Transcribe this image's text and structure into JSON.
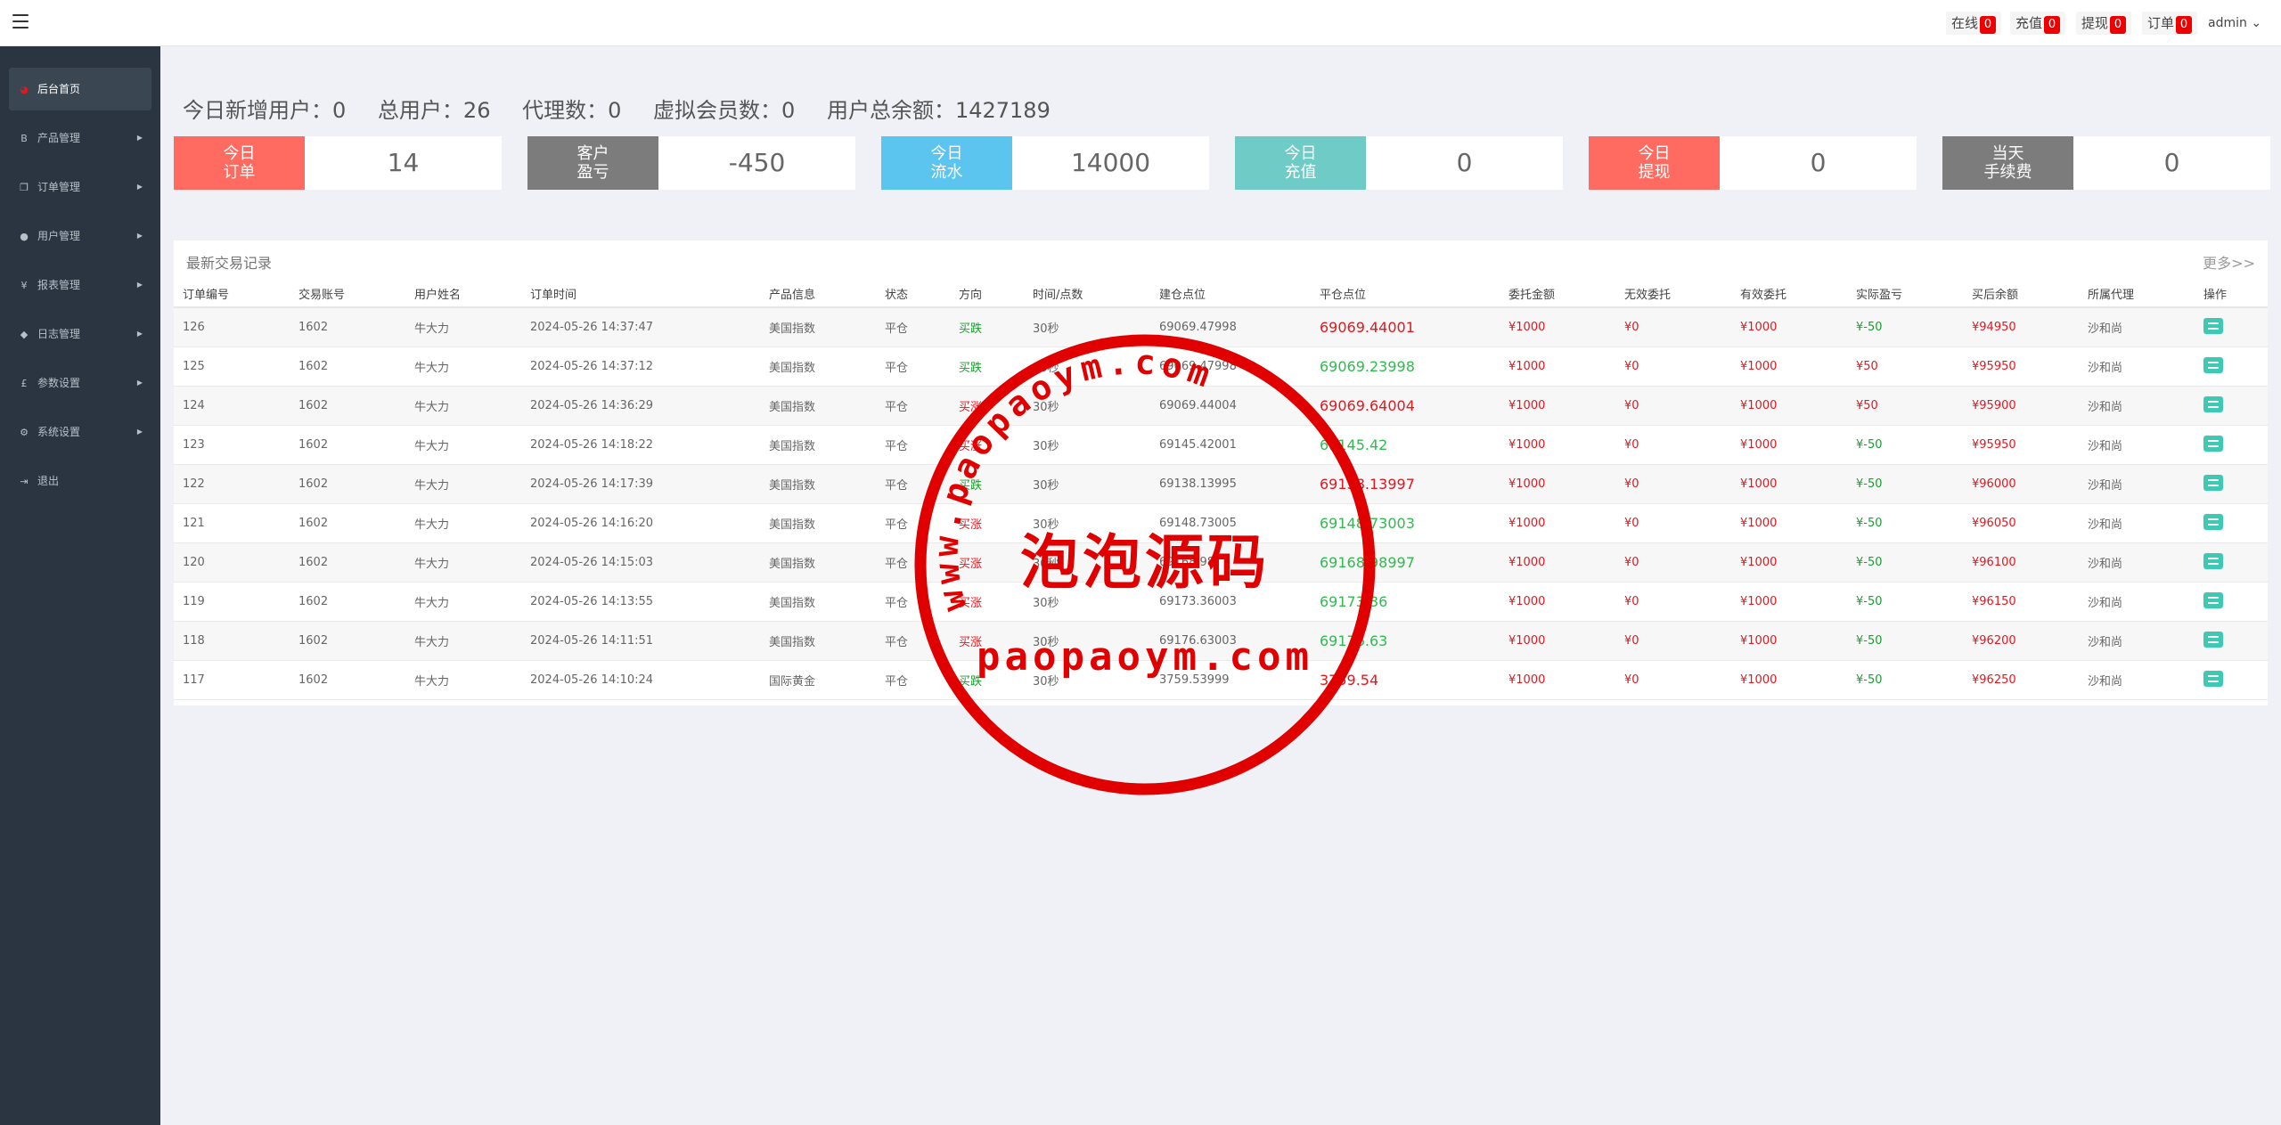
{
  "topbar": {
    "stats": [
      {
        "label": "在线",
        "count": "0"
      },
      {
        "label": "充值",
        "count": "0"
      },
      {
        "label": "提现",
        "count": "0"
      },
      {
        "label": "订单",
        "count": "0"
      }
    ],
    "admin_label": "admin ⌄"
  },
  "sidebar": {
    "items": [
      {
        "label": "后台首页",
        "icon": "dashboard-icon"
      },
      {
        "label": "产品管理",
        "icon": "bitcoin-icon"
      },
      {
        "label": "订单管理",
        "icon": "copy-icon"
      },
      {
        "label": "用户管理",
        "icon": "user-icon"
      },
      {
        "label": "报表管理",
        "icon": "yen-icon"
      },
      {
        "label": "日志管理",
        "icon": "tags-icon"
      },
      {
        "label": "参数设置",
        "icon": "pound-icon"
      },
      {
        "label": "系统设置",
        "icon": "gears-icon"
      },
      {
        "label": "退出",
        "icon": "sign-out-icon"
      }
    ]
  },
  "summary": {
    "new_users": "今日新增用户：0",
    "total_users": "总用户：26",
    "agents": "代理数：0",
    "virtual_members": "虚拟会员数：0",
    "total_balance": "用户总余额：1427189"
  },
  "stat_cards": [
    {
      "label": "今日\n订单",
      "value": "14",
      "color": "#ff6b60"
    },
    {
      "label": "客户\n盈亏",
      "value": "-450",
      "color": "#7c7c7c"
    },
    {
      "label": "今日\n流水",
      "value": "14000",
      "color": "#5bc5f0"
    },
    {
      "label": "今日\n充值",
      "value": "0",
      "color": "#6fcbc6"
    },
    {
      "label": "今日\n提现",
      "value": "0",
      "color": "#ff6b60"
    },
    {
      "label": "当天\n手续费",
      "value": "0",
      "color": "#7c7c7c"
    }
  ],
  "records": {
    "title": "最新交易记录",
    "more": "更多>>",
    "headers": [
      "订单编号",
      "交易账号",
      "用户姓名",
      "订单时间",
      "产品信息",
      "状态",
      "方向",
      "时间/点数",
      "建仓点位",
      "平仓点位",
      "委托金额",
      "无效委托",
      "有效委托",
      "实际盈亏",
      "买后余额",
      "所属代理",
      "操作"
    ],
    "rows": [
      {
        "id": "126",
        "account": "1602",
        "name": "牛大力",
        "time": "2024-05-26 14:37:47",
        "product": "美国指数",
        "status": "平仓",
        "direction": "买跌",
        "dir": "down",
        "period": "30秒",
        "open": "69069.47998",
        "close": "69069.44001",
        "close_up": false,
        "amount": "¥1000",
        "invalid": "¥0",
        "valid": "¥1000",
        "pnl": "¥-50",
        "pnl_pos": false,
        "balance": "¥94950",
        "agent": "沙和尚"
      },
      {
        "id": "125",
        "account": "1602",
        "name": "牛大力",
        "time": "2024-05-26 14:37:12",
        "product": "美国指数",
        "status": "平仓",
        "direction": "买跌",
        "dir": "down",
        "period": "30秒",
        "open": "69069.47998",
        "close": "69069.23998",
        "close_up": true,
        "amount": "¥1000",
        "invalid": "¥0",
        "valid": "¥1000",
        "pnl": "¥50",
        "pnl_pos": true,
        "balance": "¥95950",
        "agent": "沙和尚"
      },
      {
        "id": "124",
        "account": "1602",
        "name": "牛大力",
        "time": "2024-05-26 14:36:29",
        "product": "美国指数",
        "status": "平仓",
        "direction": "买涨",
        "dir": "up",
        "period": "30秒",
        "open": "69069.44004",
        "close": "69069.64004",
        "close_up": false,
        "amount": "¥1000",
        "invalid": "¥0",
        "valid": "¥1000",
        "pnl": "¥50",
        "pnl_pos": true,
        "balance": "¥95900",
        "agent": "沙和尚"
      },
      {
        "id": "123",
        "account": "1602",
        "name": "牛大力",
        "time": "2024-05-26 14:18:22",
        "product": "美国指数",
        "status": "平仓",
        "direction": "买涨",
        "dir": "up",
        "period": "30秒",
        "open": "69145.42001",
        "close": "69145.42",
        "close_up": true,
        "amount": "¥1000",
        "invalid": "¥0",
        "valid": "¥1000",
        "pnl": "¥-50",
        "pnl_pos": false,
        "balance": "¥95950",
        "agent": "沙和尚"
      },
      {
        "id": "122",
        "account": "1602",
        "name": "牛大力",
        "time": "2024-05-26 14:17:39",
        "product": "美国指数",
        "status": "平仓",
        "direction": "买跌",
        "dir": "down",
        "period": "30秒",
        "open": "69138.13995",
        "close": "69138.13997",
        "close_up": false,
        "amount": "¥1000",
        "invalid": "¥0",
        "valid": "¥1000",
        "pnl": "¥-50",
        "pnl_pos": false,
        "balance": "¥96000",
        "agent": "沙和尚"
      },
      {
        "id": "121",
        "account": "1602",
        "name": "牛大力",
        "time": "2024-05-26 14:16:20",
        "product": "美国指数",
        "status": "平仓",
        "direction": "买涨",
        "dir": "up",
        "period": "30秒",
        "open": "69148.73005",
        "close": "69148.73003",
        "close_up": true,
        "amount": "¥1000",
        "invalid": "¥0",
        "valid": "¥1000",
        "pnl": "¥-50",
        "pnl_pos": false,
        "balance": "¥96050",
        "agent": "沙和尚"
      },
      {
        "id": "120",
        "account": "1602",
        "name": "牛大力",
        "time": "2024-05-26 14:15:03",
        "product": "美国指数",
        "status": "平仓",
        "direction": "买涨",
        "dir": "up",
        "period": "30秒",
        "open": "69168.98",
        "close": "69168.98997",
        "close_up": true,
        "amount": "¥1000",
        "invalid": "¥0",
        "valid": "¥1000",
        "pnl": "¥-50",
        "pnl_pos": false,
        "balance": "¥96100",
        "agent": "沙和尚"
      },
      {
        "id": "119",
        "account": "1602",
        "name": "牛大力",
        "time": "2024-05-26 14:13:55",
        "product": "美国指数",
        "status": "平仓",
        "direction": "买涨",
        "dir": "up",
        "period": "30秒",
        "open": "69173.36003",
        "close": "69173.36",
        "close_up": true,
        "amount": "¥1000",
        "invalid": "¥0",
        "valid": "¥1000",
        "pnl": "¥-50",
        "pnl_pos": false,
        "balance": "¥96150",
        "agent": "沙和尚"
      },
      {
        "id": "118",
        "account": "1602",
        "name": "牛大力",
        "time": "2024-05-26 14:11:51",
        "product": "美国指数",
        "status": "平仓",
        "direction": "买涨",
        "dir": "up",
        "period": "30秒",
        "open": "69176.63003",
        "close": "69176.63",
        "close_up": true,
        "amount": "¥1000",
        "invalid": "¥0",
        "valid": "¥1000",
        "pnl": "¥-50",
        "pnl_pos": false,
        "balance": "¥96200",
        "agent": "沙和尚"
      },
      {
        "id": "117",
        "account": "1602",
        "name": "牛大力",
        "time": "2024-05-26 14:10:24",
        "product": "国际黄金",
        "status": "平仓",
        "direction": "买跌",
        "dir": "down",
        "period": "30秒",
        "open": "3759.53999",
        "close": "3759.54",
        "close_up": false,
        "amount": "¥1000",
        "invalid": "¥0",
        "valid": "¥1000",
        "pnl": "¥-50",
        "pnl_pos": false,
        "balance": "¥96250",
        "agent": "沙和尚"
      }
    ]
  },
  "watermark": {
    "url_text": "www.paopaoym.com",
    "cn_text": "泡泡源码",
    "domain_text": "paopaoym.com"
  }
}
